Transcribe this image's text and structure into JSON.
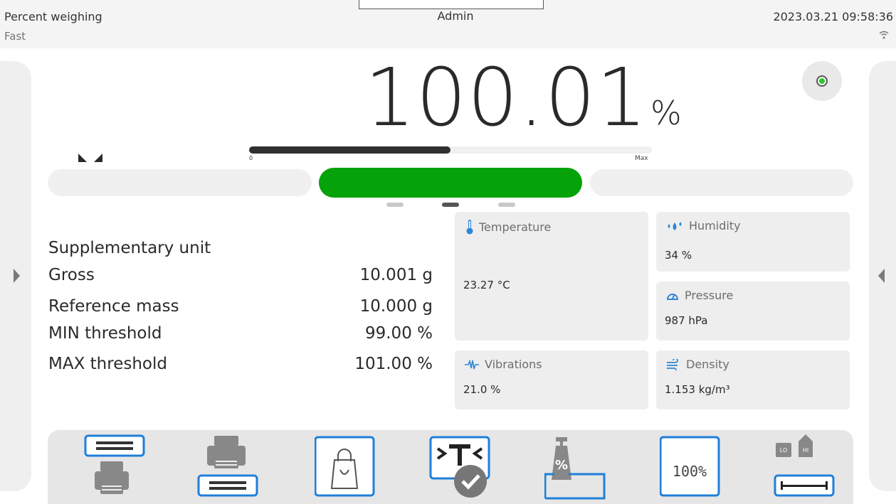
{
  "header": {
    "mode": "Percent weighing",
    "speed": "Fast",
    "user": "Admin",
    "datetime": "2023.03.21 09:58:36",
    "wifi_icon": "wifi-icon"
  },
  "reading": {
    "value": "100.01",
    "unit": "%",
    "stability_color": "#2fc62f"
  },
  "capacity_bar": {
    "min_label": "0",
    "max_label": "Max",
    "fill_fraction": 0.5
  },
  "threshold_bar": {
    "ok_color": "#05a20a"
  },
  "pager": {
    "pages": 3,
    "active": 2
  },
  "info": {
    "supplementary_label": "Supplementary unit",
    "rows": [
      {
        "label": "Gross",
        "value": "10.001 g"
      },
      {
        "label": "Reference mass",
        "value": "10.000 g"
      },
      {
        "label": "MIN threshold",
        "value": "99.00 %"
      },
      {
        "label": "MAX threshold",
        "value": "101.00 %"
      }
    ]
  },
  "environment": {
    "temperature": {
      "label": "Temperature",
      "value": "23.27 °C",
      "icon": "thermometer-icon"
    },
    "humidity": {
      "label": "Humidity",
      "value": "34 %",
      "icon": "droplets-icon"
    },
    "pressure": {
      "label": "Pressure",
      "value": "987 hPa",
      "icon": "gauge-icon"
    },
    "vibrations": {
      "label": "Vibrations",
      "value": "21.0 %",
      "icon": "vibration-icon"
    },
    "density": {
      "label": "Density",
      "value": "1.153 kg/m³",
      "icon": "wind-icon"
    }
  },
  "toolbar": {
    "tools": [
      {
        "name": "header-printout-button",
        "icon": "header-print-icon"
      },
      {
        "name": "footer-printout-button",
        "icon": "footer-print-icon"
      },
      {
        "name": "tare-database-button",
        "icon": "bag-icon"
      },
      {
        "name": "set-tare-button",
        "icon": "tare-check-icon"
      },
      {
        "name": "reference-mass-button",
        "icon": "percent-weight-icon"
      },
      {
        "name": "set-100-button",
        "icon": "100-percent-icon",
        "label": "100%"
      },
      {
        "name": "thresholds-button",
        "icon": "lo-hi-icon",
        "lo": "LO",
        "hi": "HI"
      }
    ]
  }
}
